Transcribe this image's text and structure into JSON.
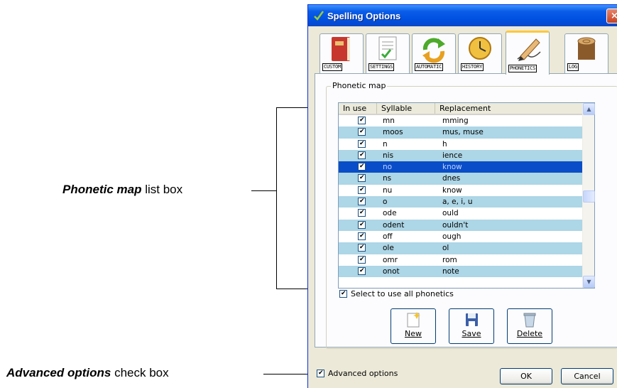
{
  "annotations": {
    "phonetic_map_bold": "Phonetic map",
    "phonetic_map_rest": " list box",
    "advanced_bold": "Advanced options",
    "advanced_rest": " check box"
  },
  "window": {
    "title": "Spelling Options",
    "close_glyph": "×"
  },
  "tabs": [
    {
      "label": "CUSTOM",
      "icon": "book-icon"
    },
    {
      "label": "SETTINGS",
      "icon": "document-check-icon"
    },
    {
      "label": "AUTOMATIC",
      "icon": "refresh-arrows-icon"
    },
    {
      "label": "HISTORY",
      "icon": "clock-icon"
    },
    {
      "label": "PHONETICS",
      "icon": "pen-icon",
      "active": true
    },
    {
      "label": "LOG",
      "icon": "log-icon"
    }
  ],
  "group": {
    "label": "Phonetic map"
  },
  "list": {
    "columns": [
      "In use",
      "Syllable",
      "Replacement"
    ],
    "rows": [
      {
        "syllable": "mn",
        "replacement": "mming"
      },
      {
        "syllable": "moos",
        "replacement": "mus, muse"
      },
      {
        "syllable": "n",
        "replacement": "h"
      },
      {
        "syllable": "nis",
        "replacement": "ience"
      },
      {
        "syllable": "no",
        "replacement": "know"
      },
      {
        "syllable": "ns",
        "replacement": "dnes"
      },
      {
        "syllable": "nu",
        "replacement": "know"
      },
      {
        "syllable": "o",
        "replacement": "a, e, i, u"
      },
      {
        "syllable": "ode",
        "replacement": "ould"
      },
      {
        "syllable": "odent",
        "replacement": "ouldn't"
      },
      {
        "syllable": "off",
        "replacement": "ough"
      },
      {
        "syllable": "ole",
        "replacement": "ol"
      },
      {
        "syllable": "omr",
        "replacement": "rom"
      },
      {
        "syllable": "onot",
        "replacement": "note"
      }
    ],
    "selected_index": 4
  },
  "select_all": {
    "label": "Select to use all phonetics",
    "checked": true
  },
  "buttons": {
    "new": "New",
    "save": "Save",
    "delete": "Delete",
    "ok": "OK",
    "cancel": "Cancel"
  },
  "advanced": {
    "label": "Advanced options",
    "checked": true
  }
}
